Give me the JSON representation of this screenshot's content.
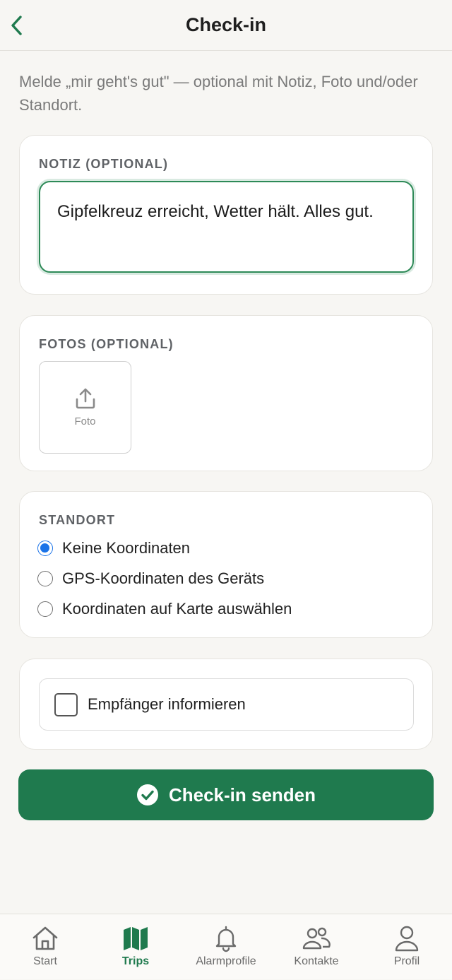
{
  "header": {
    "title": "Check-in",
    "back_icon": "chevron-left-icon"
  },
  "intro": "Melde „mir geht's gut\" — optional mit Notiz, Foto und/oder Standort.",
  "note": {
    "label": "NOTIZ (OPTIONAL)",
    "value": "Gipfelkreuz erreicht, Wetter hält. Alles gut."
  },
  "photos": {
    "label": "FOTOS (OPTIONAL)",
    "add_label": "Foto",
    "icon": "upload-icon"
  },
  "location": {
    "label": "STANDORT",
    "options": [
      {
        "label": "Keine Koordinaten",
        "selected": true
      },
      {
        "label": "GPS-Koordinaten des Geräts",
        "selected": false
      },
      {
        "label": "Koordinaten auf Karte auswählen",
        "selected": false
      }
    ]
  },
  "notify": {
    "label": "Empfänger informieren",
    "checked": false
  },
  "submit": {
    "label": "Check-in senden",
    "icon": "check-circle-icon"
  },
  "tabbar": {
    "items": [
      {
        "label": "Start",
        "icon": "home-icon",
        "active": false
      },
      {
        "label": "Trips",
        "icon": "map-icon",
        "active": true
      },
      {
        "label": "Alarmprofile",
        "icon": "bell-icon",
        "active": false
      },
      {
        "label": "Kontakte",
        "icon": "contacts-icon",
        "active": false
      },
      {
        "label": "Profil",
        "icon": "profile-icon",
        "active": false
      }
    ]
  },
  "colors": {
    "accent": "#1f7a4e",
    "radio_selected": "#1a73e8",
    "background": "#f7f6f3"
  }
}
